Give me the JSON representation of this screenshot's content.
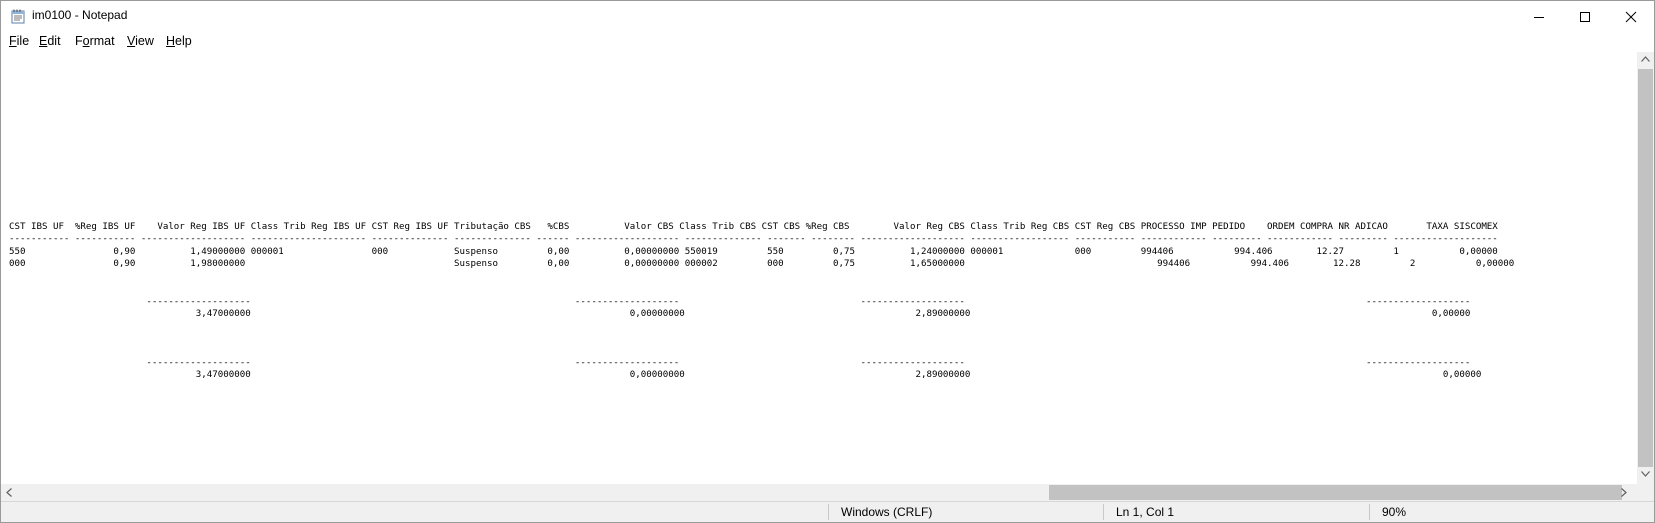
{
  "window": {
    "title": "im0100 - Notepad",
    "accent": "#ffffff"
  },
  "menu": {
    "file": {
      "accel": "F",
      "rest": "ile"
    },
    "edit": {
      "accel": "E",
      "rest": "dit"
    },
    "format": {
      "accel": "o",
      "before": "F",
      "rest": "rmat"
    },
    "view": {
      "accel": "V",
      "rest": "iew"
    },
    "help": {
      "accel": "H",
      "rest": "elp"
    }
  },
  "document": {
    "lines": [
      "CST IBS UF  %Reg IBS UF    Valor Reg IBS UF Class Trib Reg IBS UF CST Reg IBS UF Tributação CBS   %CBS          Valor CBS Class Trib CBS CST CBS %Reg CBS        Valor Reg CBS Class Trib Reg CBS CST Reg CBS PROCESSO IMP PEDIDO    ORDEM COMPRA NR ADICAO       TAXA SISCOMEX",
      "----------- ----------- ------------------- --------------------- -------------- -------------- ------ ------------------- -------------- ------- -------- ------------------- ------------------ ----------- ------------ --------- ------------ --------- -------------------",
      "550                0,90          1,49000000 000001                000            Suspenso         0,00          0,00000000 550019         550         0,75          1,24000000 000001             000         994406           994.406        12.27         1           0,00000",
      "000                0,90          1,98000000                                      Suspenso         0,00          0,00000000 000002         000         0,75          1,65000000                                   994406           994.406        12.28         2           0,00000",
      "                         -------------------                                                           -------------------                                 -------------------                                                                         -------------------",
      "                                  3,47000000                                                                     0,00000000                                          2,89000000                                                                                    0,00000",
      "                         -------------------                                                           -------------------                                 -------------------                                                                         -------------------",
      "                                  3,47000000                                                                     0,00000000                                          2,89000000                                                                                      0,00000"
    ]
  },
  "status": {
    "line_ending": "Windows (CRLF)",
    "position": "Ln 1, Col 1",
    "zoom": "90%"
  },
  "icons": {
    "app": "notepad-icon",
    "minimize": "minimize-icon",
    "maximize": "maximize-icon",
    "close": "close-icon"
  }
}
